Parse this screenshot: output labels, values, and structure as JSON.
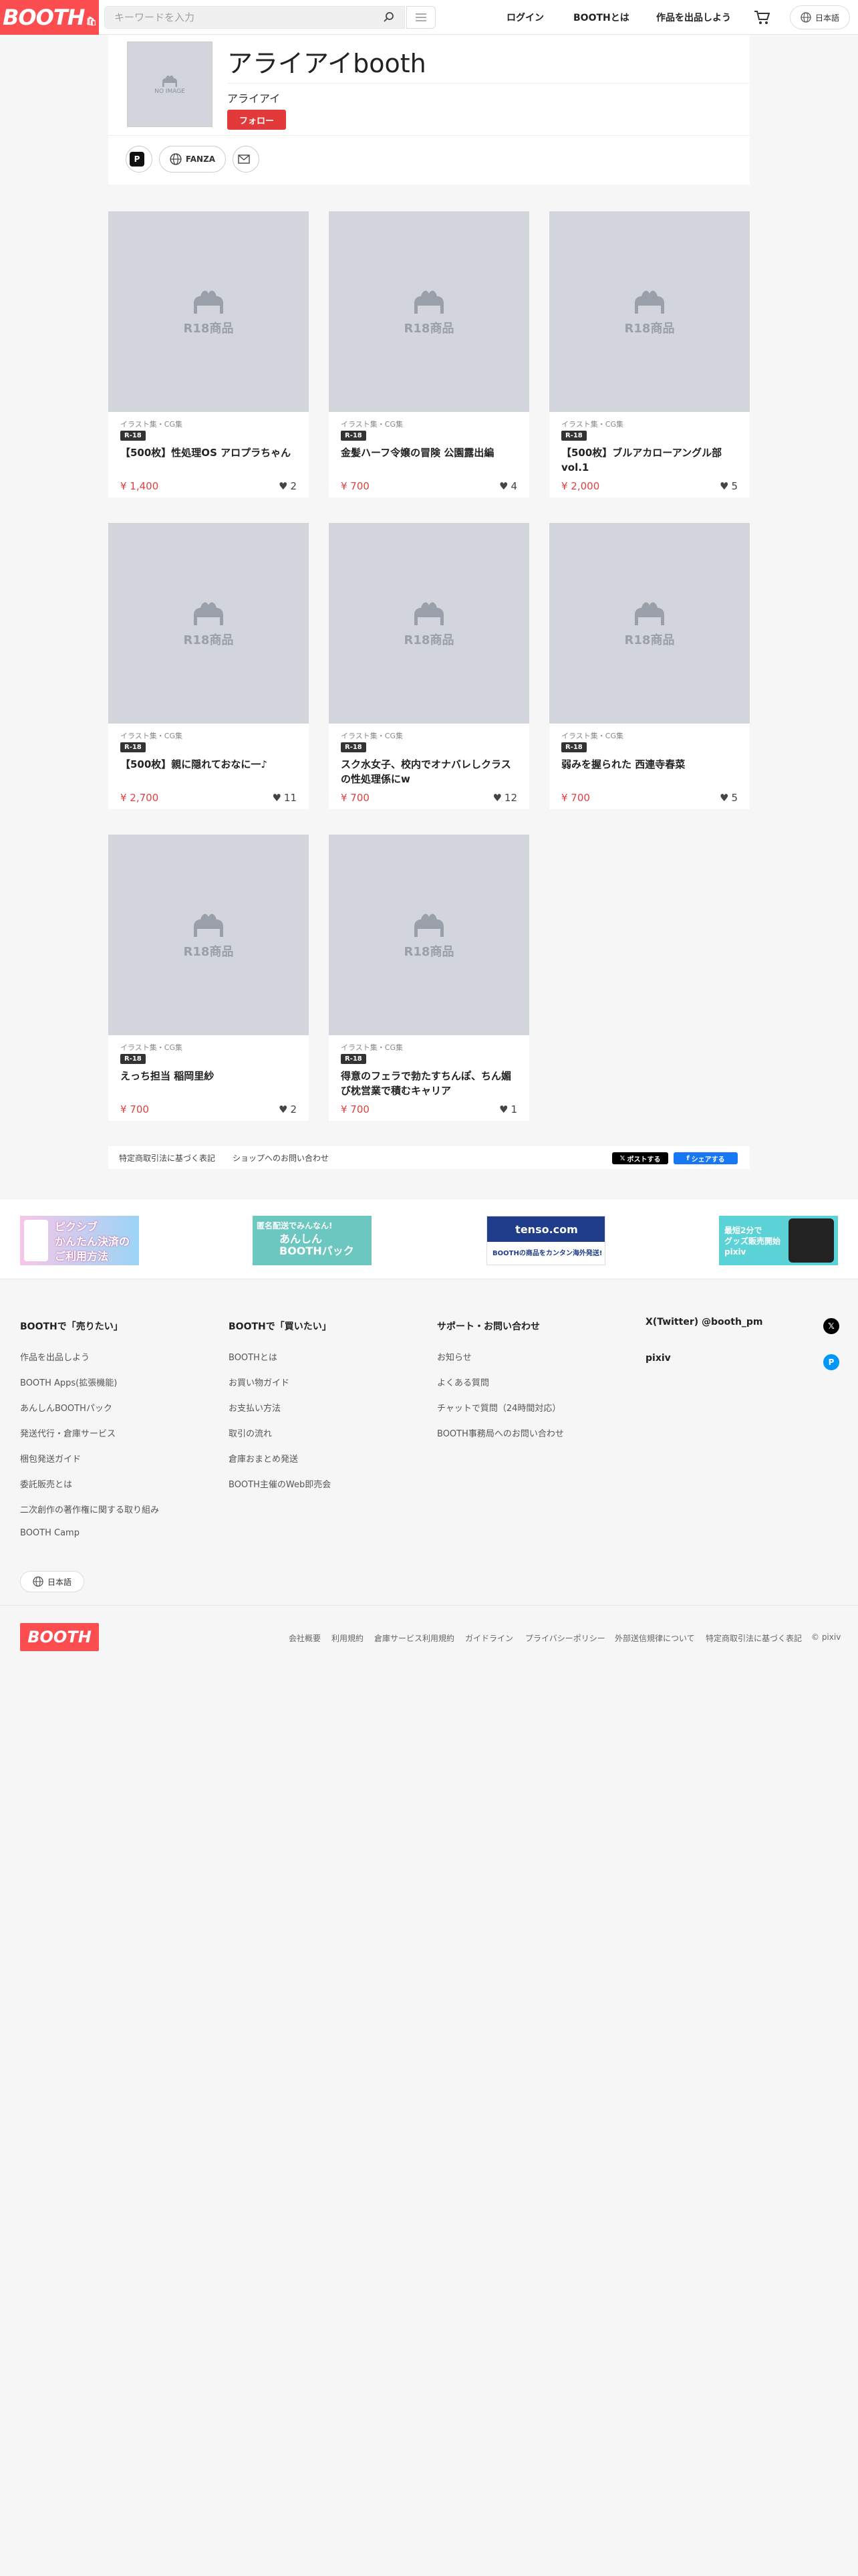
{
  "header": {
    "logo": "BOOTH",
    "search_placeholder": "キーワードを入力",
    "nav": [
      "ログイン",
      "BOOTHとは",
      "作品を出品しよう"
    ],
    "language": "日本語"
  },
  "shop": {
    "avatar_text": "NO IMAGE",
    "name": "アライアイbooth",
    "owner": "アライアイ",
    "follow_label": "フォロー",
    "links": [
      {
        "label": ""
      },
      {
        "label": "FANZA"
      },
      {
        "label": ""
      }
    ]
  },
  "items": [
    {
      "category": "イラスト集・CG集",
      "badge": "R-18",
      "thumb": "R18商品",
      "title": "【500枚】性処理OS アロプラちゃん",
      "price": "¥ 1,400",
      "likes": "2"
    },
    {
      "category": "イラスト集・CG集",
      "badge": "R-18",
      "thumb": "R18商品",
      "title": "金髪ハーフ令嬢の冒険 公園露出編",
      "price": "¥ 700",
      "likes": "4"
    },
    {
      "category": "イラスト集・CG集",
      "badge": "R-18",
      "thumb": "R18商品",
      "title": "【500枚】ブルアカローアングル部 vol.1",
      "price": "¥ 2,000",
      "likes": "5"
    },
    {
      "category": "イラスト集・CG集",
      "badge": "R-18",
      "thumb": "R18商品",
      "title": "【500枚】親に隠れておなに一♪",
      "price": "¥ 2,700",
      "likes": "11"
    },
    {
      "category": "イラスト集・CG集",
      "badge": "R-18",
      "thumb": "R18商品",
      "title": "スク水女子、校内でオナバレしクラスの性処理係にw",
      "price": "¥ 700",
      "likes": "12"
    },
    {
      "category": "イラスト集・CG集",
      "badge": "R-18",
      "thumb": "R18商品",
      "title": "弱みを握られた 西連寺春菜",
      "price": "¥ 700",
      "likes": "5"
    },
    {
      "category": "イラスト集・CG集",
      "badge": "R-18",
      "thumb": "R18商品",
      "title": "えっち担当 稲岡里紗",
      "price": "¥ 700",
      "likes": "2"
    },
    {
      "category": "イラスト集・CG集",
      "badge": "R-18",
      "thumb": "R18商品",
      "title": "得意のフェラで勃たすちんぽ、ちん媚び枕営業で積むキャリア",
      "price": "¥ 700",
      "likes": "1"
    }
  ],
  "share": {
    "links": [
      "特定商取引法に基づく表記",
      "ショップへのお問い合わせ"
    ],
    "x_post": "ポストする",
    "fb_share": "シェアする"
  },
  "banners": [
    {
      "line1": "ピクシブ",
      "line2": "かんたん決済の",
      "line3": "ご利用方法"
    },
    {
      "line1": "匿名配送でみんなん!",
      "line2": "あんしん",
      "line3": "BOOTHパック"
    },
    {
      "line1": "tenso.com",
      "line2": "BOOTHの商品をカンタン海外発送!"
    },
    {
      "line1": "最短2分で",
      "line2": "グッズ販売開始",
      "line3": "pixiv"
    }
  ],
  "footer": {
    "col1_title": "BOOTHで「売りたい」",
    "col1_links": [
      "作品を出品しよう",
      "BOOTH Apps(拡張機能)",
      "あんしんBOOTHパック",
      "発送代行・倉庫サービス",
      "梱包発送ガイド",
      "委託販売とは",
      "二次創作の著作権に関する取り組み",
      "BOOTH Camp"
    ],
    "col2_title": "BOOTHで「買いたい」",
    "col2_links": [
      "BOOTHとは",
      "お買い物ガイド",
      "お支払い方法",
      "取引の流れ",
      "倉庫おまとめ発送",
      "BOOTH主催のWeb即売会"
    ],
    "col3_title": "サポート・お問い合わせ",
    "col3_links": [
      "お知らせ",
      "よくある質問",
      "チャットで質問（24時間対応）",
      "BOOTH事務局へのお問い合わせ"
    ],
    "social": [
      {
        "label": "X(Twitter) @booth_pm"
      },
      {
        "label": "pixiv"
      }
    ],
    "language": "日本語",
    "legal": [
      "会社概要",
      "利用規約",
      "倉庫サービス利用規約",
      "ガイドライン",
      "プライバシーポリシー",
      "外部送信規律について",
      "特定商取引法に基づく表記",
      "© pixiv"
    ]
  },
  "colors": {
    "brand": "#fc4d50",
    "price": "#e24040",
    "follow": "#e23a3a"
  }
}
